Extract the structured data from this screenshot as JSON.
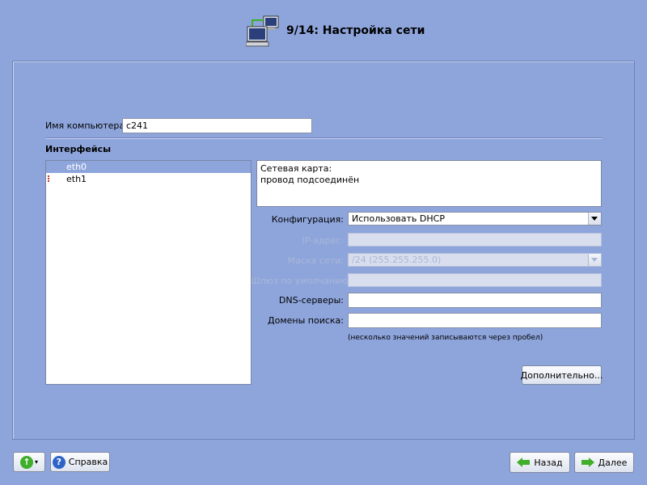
{
  "header": {
    "title": "9/14: Настройка сети",
    "icon": "network-computers-icon"
  },
  "hostname": {
    "label": "Имя компьютера:",
    "value": "c241"
  },
  "interfaces": {
    "title": "Интерфейсы",
    "items": [
      {
        "name": "eth0",
        "selected": true
      },
      {
        "name": "eth1",
        "selected": false
      }
    ]
  },
  "info": {
    "line1": "Сетевая карта:",
    "line2": "провод подсоединён"
  },
  "form": {
    "config_label": "Конфигурация:",
    "config_value": "Использовать DHCP",
    "ip_label": "IP-адрес:",
    "ip_value": "",
    "mask_label": "Маска сети:",
    "mask_value": "/24 (255.255.255.0)",
    "gateway_label": "Шлюз по умолчанию:",
    "gateway_value": "",
    "dns_label": "DNS-серверы:",
    "dns_value": "",
    "search_label": "Домены поиска:",
    "search_value": "",
    "hint": "(несколько значений записываются через пробел)",
    "advanced_button": "Дополнительно..."
  },
  "footer": {
    "help_button": "Справка",
    "back_button": "Назад",
    "next_button": "Далее"
  },
  "colors": {
    "background": "#8ea5dc",
    "selection": "#8ea5dc",
    "green_arrow": "#3fae2a",
    "help_blue": "#2e63c8"
  }
}
